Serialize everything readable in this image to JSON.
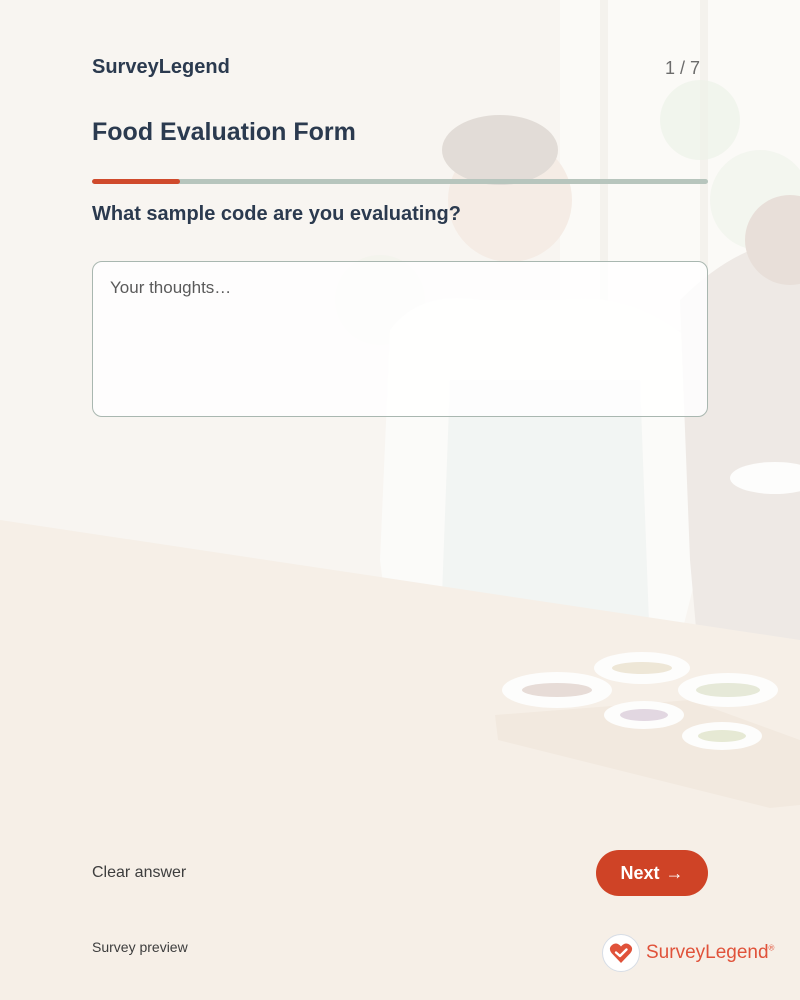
{
  "app": {
    "brand": "SurveyLegend",
    "page_counter": "1 / 7"
  },
  "form": {
    "title": "Food Evaluation Form",
    "progress": 0.143
  },
  "question": {
    "text": "What sample code are you evaluating?",
    "answer_value": "",
    "answer_placeholder": "Your thoughts…"
  },
  "actions": {
    "clear_label": "Clear answer",
    "next_label": "Next",
    "next_icon": "arrow-right-icon"
  },
  "footer": {
    "preview_label": "Survey preview",
    "logo_text": "SurveyLegend",
    "logo_mark": "®",
    "logo_icon": "heart-check-icon"
  },
  "colors": {
    "accent": "#cf4326",
    "heading": "#2b3a4f",
    "progress_track": "#b7c5bd"
  }
}
